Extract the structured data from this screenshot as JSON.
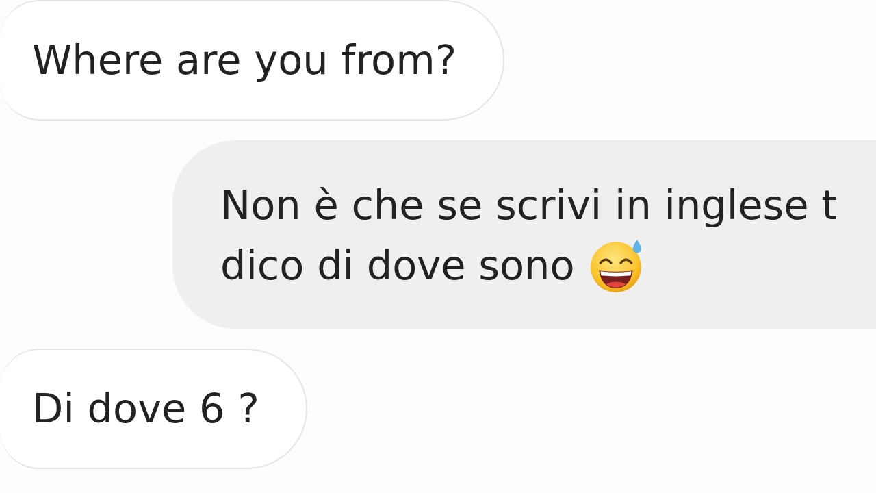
{
  "messages": [
    {
      "kind": "received",
      "lines": [
        "Where are you from?"
      ],
      "emoji": false
    },
    {
      "kind": "sent",
      "lines": [
        "Non è che se scrivi in inglese t",
        "dico di dove sono"
      ],
      "emoji": true
    },
    {
      "kind": "received",
      "lines": [
        "Di dove 6 ?"
      ],
      "emoji": false
    }
  ]
}
